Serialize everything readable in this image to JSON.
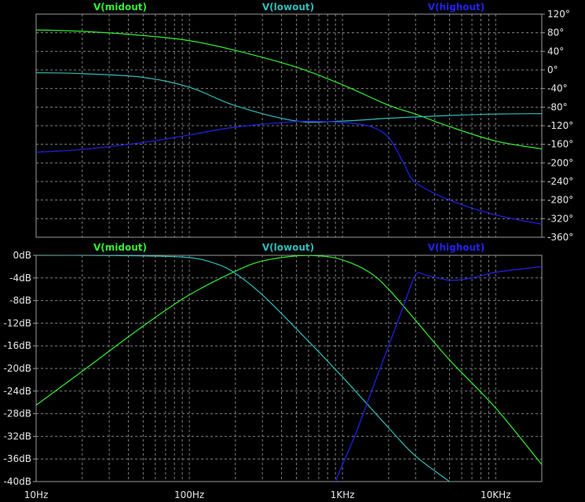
{
  "chart_data": [
    {
      "type": "line",
      "title": "",
      "xlabel": "",
      "ylabel": "",
      "x_scale": "log",
      "xlim": [
        10,
        20000
      ],
      "ylim": [
        -360,
        120
      ],
      "grid": true,
      "legend_position": "top",
      "x_ticks": [],
      "y_ticks": [
        {
          "value": 120,
          "label": "120°"
        },
        {
          "value": 80,
          "label": "80°"
        },
        {
          "value": 40,
          "label": "40°"
        },
        {
          "value": 0,
          "label": "0°"
        },
        {
          "value": -40,
          "label": "-40°"
        },
        {
          "value": -80,
          "label": "-80°"
        },
        {
          "value": -120,
          "label": "-120°"
        },
        {
          "value": -160,
          "label": "-160°"
        },
        {
          "value": -200,
          "label": "-200°"
        },
        {
          "value": -240,
          "label": "-240°"
        },
        {
          "value": -280,
          "label": "-280°"
        },
        {
          "value": -320,
          "label": "-320°"
        },
        {
          "value": -360,
          "label": "-360°"
        }
      ],
      "series": [
        {
          "name": "V(midout)",
          "color": "#33ee33",
          "x": [
            10,
            20,
            50,
            100,
            200,
            500,
            1000,
            2000,
            3000,
            5000,
            10000,
            20000
          ],
          "y": [
            86,
            83,
            74,
            63,
            42,
            6,
            -32,
            -76,
            -95,
            -122,
            -153,
            -170
          ]
        },
        {
          "name": "V(lowout)",
          "color": "#33bbbb",
          "x": [
            10,
            20,
            50,
            100,
            200,
            500,
            1000,
            2000,
            5000,
            10000,
            20000
          ],
          "y": [
            -6,
            -8,
            -16,
            -37,
            -77,
            -110,
            -110,
            -104,
            -98,
            -95,
            -94
          ]
        },
        {
          "name": "V(highout)",
          "color": "#2222ee",
          "x": [
            10,
            20,
            50,
            100,
            200,
            500,
            700,
            1000,
            1500,
            2000,
            2500,
            3000,
            5000,
            10000,
            20000
          ],
          "y": [
            -177,
            -171,
            -156,
            -140,
            -123,
            -111,
            -111,
            -113,
            -121,
            -145,
            -200,
            -242,
            -280,
            -312,
            -332
          ]
        }
      ]
    },
    {
      "type": "line",
      "title": "",
      "xlabel": "",
      "ylabel": "",
      "x_scale": "log",
      "xlim": [
        10,
        20000
      ],
      "ylim": [
        -40,
        0
      ],
      "grid": true,
      "legend_position": "top",
      "x_ticks": [
        {
          "value": 10,
          "label": "10Hz"
        },
        {
          "value": 100,
          "label": "100Hz"
        },
        {
          "value": 1000,
          "label": "1KHz"
        },
        {
          "value": 10000,
          "label": "10KHz"
        }
      ],
      "y_ticks": [
        {
          "value": 0,
          "label": "0dB"
        },
        {
          "value": -4,
          "label": "-4dB"
        },
        {
          "value": -8,
          "label": "-8dB"
        },
        {
          "value": -12,
          "label": "-12dB"
        },
        {
          "value": -16,
          "label": "-16dB"
        },
        {
          "value": -20,
          "label": "-20dB"
        },
        {
          "value": -24,
          "label": "-24dB"
        },
        {
          "value": -28,
          "label": "-28dB"
        },
        {
          "value": -32,
          "label": "-32dB"
        },
        {
          "value": -36,
          "label": "-36dB"
        },
        {
          "value": -40,
          "label": "-40dB"
        }
      ],
      "series": [
        {
          "name": "V(midout)",
          "color": "#33ee33",
          "x": [
            10,
            20,
            50,
            100,
            200,
            300,
            500,
            700,
            1000,
            1500,
            2000,
            3000,
            5000,
            10000,
            20000
          ],
          "y": [
            -26.5,
            -20.5,
            -12.5,
            -7.0,
            -2.8,
            -1.0,
            -0.1,
            -0.1,
            -0.8,
            -3.0,
            -6.0,
            -11.5,
            -18.5,
            -27.0,
            -37.0
          ]
        },
        {
          "name": "V(lowout)",
          "color": "#33bbbb",
          "x": [
            10,
            20,
            50,
            100,
            150,
            200,
            300,
            500,
            1000,
            2000,
            3000,
            5000
          ],
          "y": [
            0,
            0,
            -0.1,
            -0.4,
            -1.5,
            -3.2,
            -7.0,
            -13.0,
            -21.5,
            -30.5,
            -35.5,
            -40.0
          ]
        },
        {
          "name": "V(highout)",
          "color": "#2222ee",
          "x": [
            900,
            1000,
            1200,
            1500,
            2000,
            2500,
            3000,
            3500,
            5000,
            7000,
            10000,
            20000
          ],
          "y": [
            -40,
            -37.0,
            -32.0,
            -25.0,
            -16.0,
            -9.0,
            -3.5,
            -3.5,
            -4.4,
            -4.0,
            -3.0,
            -2.0
          ]
        }
      ]
    }
  ]
}
